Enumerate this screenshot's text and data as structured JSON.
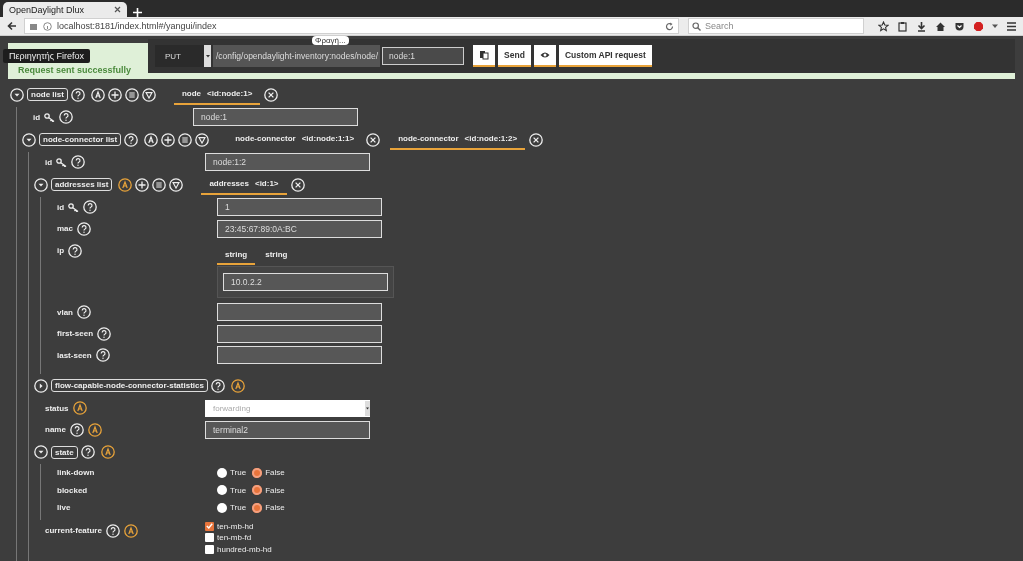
{
  "browser": {
    "tab_title": "OpenDaylight Dlux",
    "url": "localhost:8181/index.html#/yangui/index",
    "search": {
      "placeholder": "Search"
    }
  },
  "tooltips": [
    {
      "text": "Περιηγητής Firefox",
      "kind": "dark"
    },
    {
      "text": "Φραγή...",
      "kind": "light"
    }
  ],
  "banner": {
    "message": "Request sent successfully"
  },
  "api_bar": {
    "method": "PUT",
    "path": "/config/opendaylight-inventory:nodes/node/",
    "key_value": "node:1",
    "buttons": [
      {
        "kind": "copy"
      },
      {
        "kind": "text",
        "label": "Send"
      },
      {
        "kind": "preview"
      },
      {
        "kind": "text",
        "label": "Custom API request"
      }
    ]
  },
  "tree": [
    {
      "kind": "list",
      "label": "node list",
      "expanded": true,
      "help": true,
      "augment_highlighted": false,
      "tabs": [
        {
          "name": "node",
          "key": "<id:node:1>",
          "selected": true
        }
      ],
      "children": [
        {
          "kind": "leaf",
          "label": "id",
          "key": true,
          "help": true,
          "field": {
            "kind": "text",
            "value": "node:1"
          }
        },
        {
          "kind": "list",
          "label": "node-connector list",
          "expanded": true,
          "help": true,
          "augment_highlighted": false,
          "tabs": [
            {
              "name": "node-connector",
              "key": "<id:node:1:1>",
              "selected": false
            },
            {
              "name": "node-connector",
              "key": "<id:node:1:2>",
              "selected": true
            }
          ],
          "children": [
            {
              "kind": "leaf",
              "label": "id",
              "key": true,
              "help": true,
              "field": {
                "kind": "text",
                "value": "node:1:2"
              }
            },
            {
              "kind": "list",
              "label": "addresses list",
              "expanded": true,
              "help": false,
              "augment_highlighted": true,
              "tabs": [
                {
                  "name": "addresses",
                  "key": "<id:1>",
                  "selected": true
                }
              ],
              "children": [
                {
                  "kind": "leaf",
                  "label": "id",
                  "key": true,
                  "help": true,
                  "field": {
                    "kind": "text",
                    "value": "1"
                  }
                },
                {
                  "kind": "leaf",
                  "label": "mac",
                  "key": false,
                  "help": true,
                  "field": {
                    "kind": "text",
                    "value": "23:45:67:89:0A:BC"
                  }
                },
                {
                  "kind": "leaf",
                  "label": "ip",
                  "key": false,
                  "help": true,
                  "field": {
                    "kind": "leaf-list",
                    "tabs": [
                      {
                        "label": "string",
                        "selected": true
                      },
                      {
                        "label": "string",
                        "selected": false
                      }
                    ],
                    "value": "10.0.2.2"
                  }
                },
                {
                  "kind": "leaf",
                  "label": "vlan",
                  "key": false,
                  "help": true,
                  "field": {
                    "kind": "text"
                  }
                },
                {
                  "kind": "leaf",
                  "label": "first-seen",
                  "key": false,
                  "help": true,
                  "field": {
                    "kind": "text"
                  }
                },
                {
                  "kind": "leaf",
                  "label": "last-seen",
                  "key": false,
                  "help": true,
                  "field": {
                    "kind": "text"
                  }
                }
              ]
            },
            {
              "kind": "container",
              "label": "flow-capable-node-connector-statistics",
              "expanded": false,
              "help": true,
              "augment_highlighted": true
            },
            {
              "kind": "leaf",
              "label": "status",
              "key": false,
              "help": false,
              "augment_highlighted": true,
              "field": {
                "kind": "select",
                "value": "forwarding"
              }
            },
            {
              "kind": "leaf",
              "label": "name",
              "key": false,
              "help": true,
              "augment_highlighted": true,
              "field": {
                "kind": "text",
                "value": "terminal2"
              }
            },
            {
              "kind": "container",
              "label": "state",
              "expanded": true,
              "help": true,
              "augment_highlighted": true,
              "children": [
                {
                  "kind": "leaf",
                  "label": "link-down",
                  "key": false,
                  "help": false,
                  "field": {
                    "kind": "radio",
                    "options": [
                      {
                        "label": "True",
                        "selected": false
                      },
                      {
                        "label": "False",
                        "selected": true
                      }
                    ]
                  }
                },
                {
                  "kind": "leaf",
                  "label": "blocked",
                  "key": false,
                  "help": false,
                  "field": {
                    "kind": "radio",
                    "options": [
                      {
                        "label": "True",
                        "selected": false
                      },
                      {
                        "label": "False",
                        "selected": true
                      }
                    ]
                  }
                },
                {
                  "kind": "leaf",
                  "label": "live",
                  "key": false,
                  "help": false,
                  "field": {
                    "kind": "radio",
                    "options": [
                      {
                        "label": "True",
                        "selected": false
                      },
                      {
                        "label": "False",
                        "selected": true
                      }
                    ]
                  }
                }
              ]
            },
            {
              "kind": "leaf",
              "label": "current-feature",
              "key": false,
              "help": true,
              "augment_highlighted": true,
              "field": {
                "kind": "checkboxes",
                "options": [
                  {
                    "label": "ten-mb-hd",
                    "checked": true
                  },
                  {
                    "label": "ten-mb-fd",
                    "checked": false
                  },
                  {
                    "label": "hundred-mb-hd",
                    "checked": false
                  }
                ]
              }
            }
          ]
        }
      ]
    }
  ]
}
